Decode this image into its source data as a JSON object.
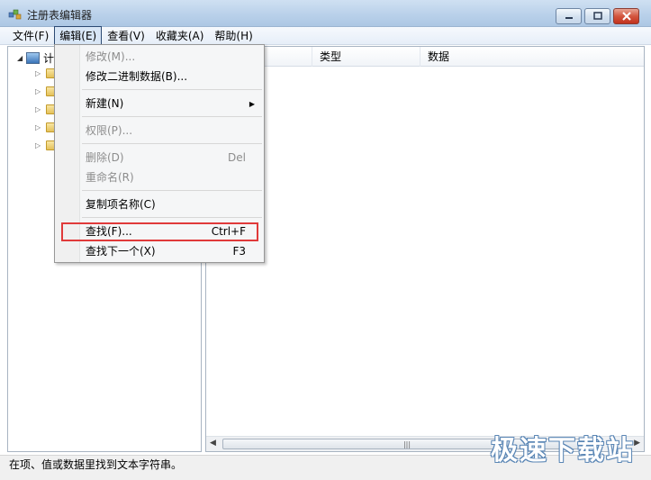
{
  "window": {
    "title": "注册表编辑器",
    "minimize_icon": "minimize-icon",
    "maximize_icon": "maximize-icon",
    "close_icon": "close-icon"
  },
  "menubar": {
    "items": [
      "文件(F)",
      "编辑(E)",
      "查看(V)",
      "收藏夹(A)",
      "帮助(H)"
    ],
    "active": "编辑(E)"
  },
  "tree": {
    "root_label": "计",
    "children_count_visible": 5
  },
  "list": {
    "columns": [
      "",
      "类型",
      "数据"
    ]
  },
  "edit_menu": {
    "items": [
      {
        "label": "修改(M)...",
        "shortcut": "",
        "disabled": true
      },
      {
        "label": "修改二进制数据(B)...",
        "shortcut": "",
        "disabled": false
      },
      {
        "label": "新建(N)",
        "shortcut": "",
        "disabled": false,
        "submenu": true
      },
      {
        "label": "权限(P)...",
        "shortcut": "",
        "disabled": true
      },
      {
        "label": "删除(D)",
        "shortcut": "Del",
        "disabled": true
      },
      {
        "label": "重命名(R)",
        "shortcut": "",
        "disabled": true
      },
      {
        "label": "复制项名称(C)",
        "shortcut": "",
        "disabled": false
      },
      {
        "label": "查找(F)...",
        "shortcut": "Ctrl+F",
        "disabled": false,
        "highlighted": true
      },
      {
        "label": "查找下一个(X)",
        "shortcut": "F3",
        "disabled": false
      }
    ]
  },
  "statusbar": {
    "text": "在项、值或数据里找到文本字符串。"
  },
  "watermark": {
    "text": "极速下载站"
  },
  "colors": {
    "highlight_border": "#e03a3a",
    "titlebar": "#bad1ea"
  }
}
